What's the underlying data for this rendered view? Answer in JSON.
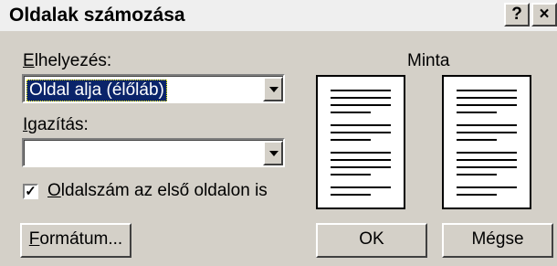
{
  "dialog": {
    "title": "Oldalak számozása",
    "help_label": "?",
    "close_label": "×"
  },
  "position": {
    "label_first": "E",
    "label_rest": "lhelyezés:",
    "selected": "Oldal alja (élőláb)"
  },
  "alignment": {
    "label_first": "I",
    "label_rest": "gazítás:",
    "selected": ""
  },
  "first_page": {
    "checked": true,
    "check_glyph": "✓",
    "label_first": "O",
    "label_rest": "ldalszám az első oldalon is"
  },
  "buttons": {
    "format_first": "F",
    "format_rest": "ormátum...",
    "ok": "OK",
    "cancel": "Mégse"
  },
  "preview": {
    "label": "Minta"
  }
}
